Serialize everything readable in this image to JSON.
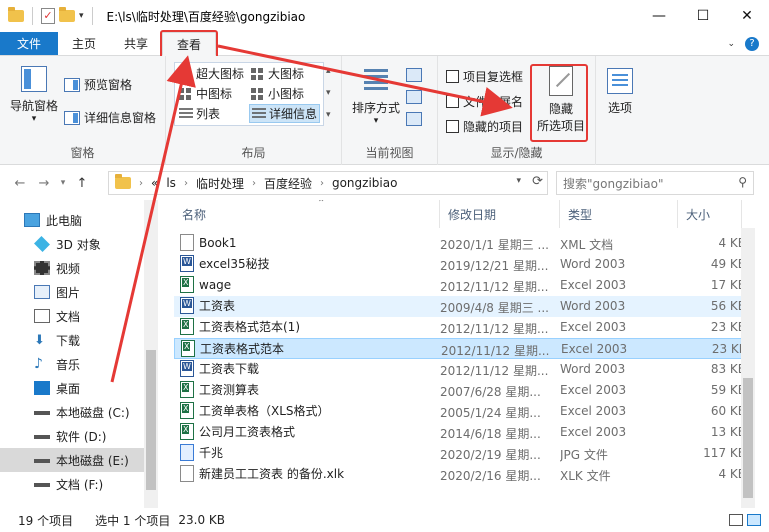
{
  "window": {
    "title": "E:\\ls\\临时处理\\百度经验\\gongzibiao",
    "min": "—",
    "max": "☐",
    "close": "✕"
  },
  "tabs": {
    "file": "文件",
    "home": "主页",
    "share": "共享",
    "view": "查看"
  },
  "ribbon": {
    "panes": {
      "nav_pane": "导航窗格",
      "preview": "预览窗格",
      "details": "详细信息窗格",
      "label": "窗格"
    },
    "layout": {
      "label": "布局",
      "xlarge": "超大图标",
      "large": "大图标",
      "medium": "中图标",
      "small": "小图标",
      "list": "列表",
      "details": "详细信息"
    },
    "current_view": {
      "sort": "排序方式",
      "label": "当前视图"
    },
    "show_hide": {
      "label": "显示/隐藏",
      "item_checkbox": "项目复选框",
      "file_ext": "文件扩展名",
      "hidden_items": "隐藏的项目",
      "hide_selected_1": "隐藏",
      "hide_selected_2": "所选项目"
    },
    "options": "选项"
  },
  "address": {
    "crumbs": [
      "«",
      "ls",
      "临时处理",
      "百度经验",
      "gongzibiao"
    ],
    "search_placeholder": "搜索\"gongzibiao\""
  },
  "nav": [
    {
      "label": "此电脑",
      "icon": "pc-icon"
    },
    {
      "label": "3D 对象",
      "icon": "cube-icon"
    },
    {
      "label": "视频",
      "icon": "film-icon"
    },
    {
      "label": "图片",
      "icon": "picture-icon"
    },
    {
      "label": "文档",
      "icon": "document-icon"
    },
    {
      "label": "下载",
      "icon": "download-icon"
    },
    {
      "label": "音乐",
      "icon": "music-icon"
    },
    {
      "label": "桌面",
      "icon": "desktop-icon"
    },
    {
      "label": "本地磁盘 (C:)",
      "icon": "drive-icon"
    },
    {
      "label": "软件 (D:)",
      "icon": "drive-icon"
    },
    {
      "label": "本地磁盘 (E:)",
      "icon": "drive-icon"
    },
    {
      "label": "文档 (F:)",
      "icon": "drive-icon"
    }
  ],
  "columns": {
    "name": "名称",
    "date": "修改日期",
    "type": "类型",
    "size": "大小"
  },
  "files": [
    {
      "name": "Book1",
      "date": "2020/1/1 星期三 ...",
      "type": "XML 文档",
      "size": "4 KB",
      "icon": "plain"
    },
    {
      "name": "excel35秘技",
      "date": "2019/12/21 星期...",
      "type": "Word 2003",
      "size": "49 KB",
      "icon": "word"
    },
    {
      "name": "wage",
      "date": "2012/11/12 星期...",
      "type": "Excel 2003",
      "size": "17 KB",
      "icon": "excel"
    },
    {
      "name": "工资表",
      "date": "2009/4/8 星期三 ...",
      "type": "Word 2003",
      "size": "56 KB",
      "icon": "word"
    },
    {
      "name": "工资表格式范本(1)",
      "date": "2012/11/12 星期...",
      "type": "Excel 2003",
      "size": "23 KB",
      "icon": "excel"
    },
    {
      "name": "工资表格式范本",
      "date": "2012/11/12 星期...",
      "type": "Excel 2003",
      "size": "23 KB",
      "icon": "excel"
    },
    {
      "name": "工资表下载",
      "date": "2012/11/12 星期...",
      "type": "Word 2003",
      "size": "83 KB",
      "icon": "word"
    },
    {
      "name": "工资测算表",
      "date": "2007/6/28 星期...",
      "type": "Excel 2003",
      "size": "59 KB",
      "icon": "excel"
    },
    {
      "name": "工资单表格（XLS格式）",
      "date": "2005/1/24 星期...",
      "type": "Excel 2003",
      "size": "60 KB",
      "icon": "excel"
    },
    {
      "name": "公司月工资表格式",
      "date": "2014/6/18 星期...",
      "type": "Excel 2003",
      "size": "13 KB",
      "icon": "excel"
    },
    {
      "name": "千兆",
      "date": "2020/2/19 星期...",
      "type": "JPG 文件",
      "size": "117 KB",
      "icon": "jpg"
    },
    {
      "name": "新建员工工资表 的备份.xlk",
      "date": "2020/2/16 星期...",
      "type": "XLK 文件",
      "size": "4 KB",
      "icon": "plain"
    }
  ],
  "status": {
    "count": "19 个项目",
    "selected": "选中 1 个项目",
    "size": "23.0 KB"
  },
  "colors": {
    "accent": "#1979ca",
    "annotation": "#e53935"
  }
}
